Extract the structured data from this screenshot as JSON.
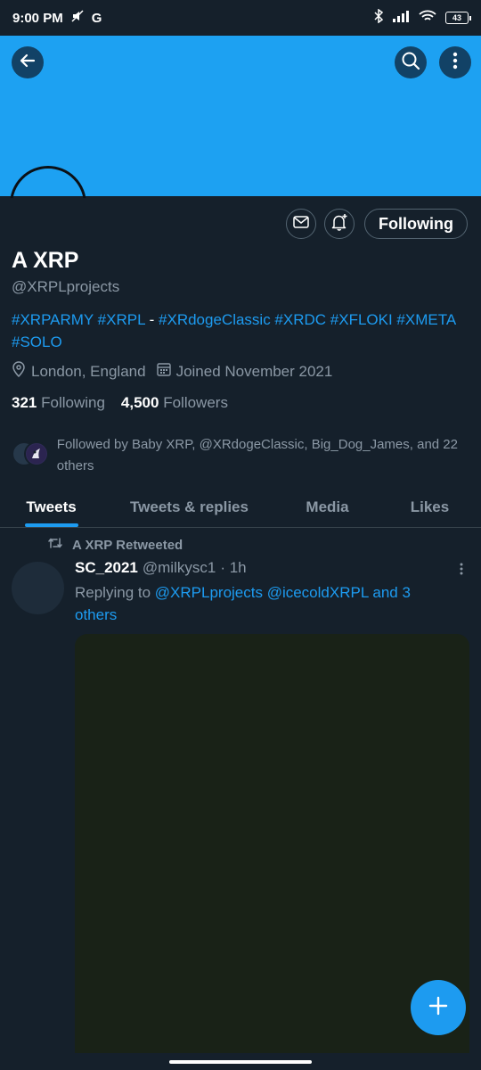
{
  "status_bar": {
    "time": "9:00 PM",
    "carrier_glyph": "G",
    "battery": "43"
  },
  "colors": {
    "accent": "#1d9bf0",
    "banner": "#1da1f2",
    "background": "#15202b",
    "muted": "#8b98a5"
  },
  "header": {
    "back_icon": "arrow-left-icon",
    "search_icon": "search-icon",
    "more_icon": "more-vertical-icon"
  },
  "actions": {
    "message_icon": "envelope-icon",
    "notify_icon": "bell-plus-icon",
    "following_label": "Following"
  },
  "profile": {
    "name": "A XRP",
    "handle": "@XRPLprojects",
    "bio_part1": "#XRPARMY #XRPL",
    "bio_sep": " - ",
    "bio_part2": "#XRdogeClassic #XRDC #XFLOKI #XMETA #SOLO",
    "location": "London, England",
    "joined": "Joined November 2021",
    "following_count": "321",
    "following_label": "Following",
    "followers_count": "4,500",
    "followers_label": "Followers",
    "followed_by": "Followed by Baby XRP, @XRdogeClassic, Big_Dog_James, and 22 others"
  },
  "tabs": [
    "Tweets",
    "Tweets & replies",
    "Media",
    "Likes"
  ],
  "tweet": {
    "retweet_label": "A XRP Retweeted",
    "author_name": "SC_2021",
    "author_handle": "@milkysc1",
    "time": "· 1h",
    "reply_prefix": "Replying to ",
    "reply_targets": "@XRPLprojects @icecoldXRPL and 3 others"
  },
  "fab_icon": "plus-icon"
}
